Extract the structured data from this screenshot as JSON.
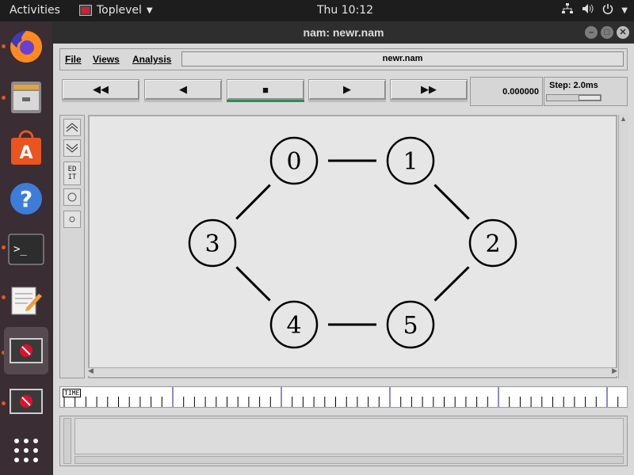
{
  "topbar": {
    "activities": "Activities",
    "app_name": "Toplevel",
    "clock": "Thu 10:12"
  },
  "dock": {
    "items": [
      {
        "name": "firefox",
        "running": true
      },
      {
        "name": "files",
        "running": true
      },
      {
        "name": "software",
        "running": false
      },
      {
        "name": "help",
        "running": false
      },
      {
        "name": "terminal",
        "running": true
      },
      {
        "name": "text-editor",
        "running": true
      },
      {
        "name": "nam-window-1",
        "running": true,
        "active": true
      },
      {
        "name": "nam-window-2",
        "running": true
      },
      {
        "name": "show-applications",
        "running": false
      }
    ]
  },
  "window": {
    "title": "nam: newr.nam"
  },
  "menubar": {
    "file": "File",
    "views": "Views",
    "analysis": "Analysis",
    "filename": "newr.nam"
  },
  "controls": {
    "time": "0.000000",
    "step": "Step: 2.0ms"
  },
  "tools": {
    "edit": "ED\nIT"
  },
  "network": {
    "nodes": [
      "0",
      "1",
      "2",
      "3",
      "4",
      "5"
    ],
    "links": [
      [
        "0",
        "1"
      ],
      [
        "1",
        "2"
      ],
      [
        "2",
        "5"
      ],
      [
        "5",
        "4"
      ],
      [
        "4",
        "3"
      ],
      [
        "3",
        "0"
      ]
    ]
  },
  "timeline": {
    "label": "TIME"
  },
  "colors": {
    "play_indicator": "#2e8b57",
    "timeline_major": "#1a1a8c",
    "accent": "#e95420"
  }
}
